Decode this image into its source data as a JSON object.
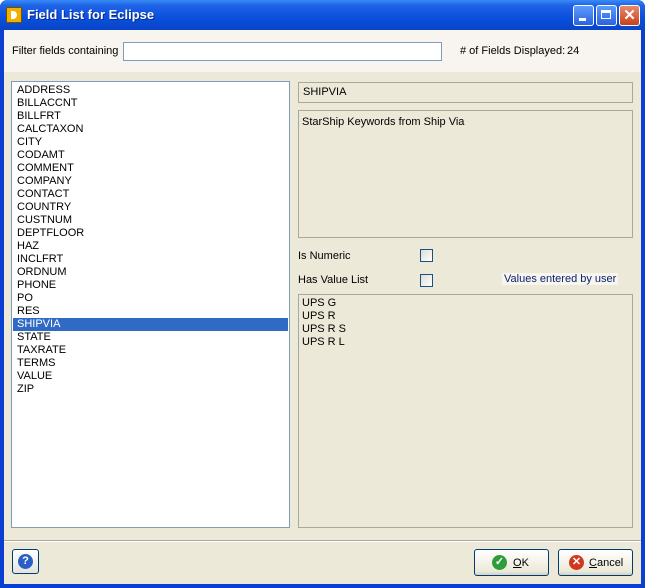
{
  "window": {
    "title": "Field List for Eclipse"
  },
  "filter": {
    "label": "Filter fields containing",
    "value": "",
    "count_label": "# of Fields Displayed:",
    "count_value": "24"
  },
  "field_list": {
    "items": [
      "ADDRESS",
      "BILLACCNT",
      "BILLFRT",
      "CALCTAXON",
      "CITY",
      "CODAMT",
      "COMMENT",
      "COMPANY",
      "CONTACT",
      "COUNTRY",
      "CUSTNUM",
      "DEPTFLOOR",
      "HAZ",
      "INCLFRT",
      "ORDNUM",
      "PHONE",
      "PO",
      "RES",
      "SHIPVIA",
      "STATE",
      "TAXRATE",
      "TERMS",
      "VALUE",
      "ZIP"
    ],
    "selected": "SHIPVIA"
  },
  "details": {
    "field_name": "SHIPVIA",
    "description": "StarShip Keywords from Ship Via",
    "is_numeric_label": "Is Numeric",
    "is_numeric": false,
    "has_value_list_label": "Has Value List",
    "has_value_list": false,
    "values_note": "Values entered by user",
    "values": [
      "UPS G",
      "UPS R",
      "UPS R S",
      "UPS R L"
    ]
  },
  "buttons": {
    "ok_prefix": "",
    "ok_underline": "O",
    "ok_rest": "K",
    "cancel_underline": "C",
    "cancel_rest": "ancel"
  },
  "colors": {
    "titlebar": "#0a4fdc",
    "selection": "#316ac5",
    "dialog_face": "#ece9d8"
  }
}
